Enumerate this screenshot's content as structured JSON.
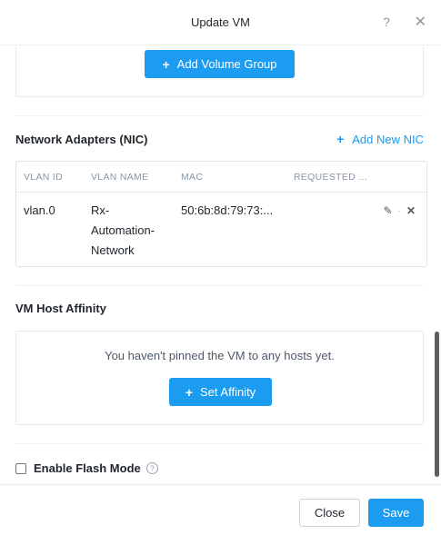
{
  "header": {
    "title": "Update VM",
    "help_icon": "?",
    "close_icon": "✕"
  },
  "volume": {
    "add_label": "Add Volume Group"
  },
  "nic": {
    "title": "Network Adapters (NIC)",
    "add_label": "Add New NIC",
    "columns": [
      "VLAN ID",
      "VLAN NAME",
      "MAC",
      "REQUESTED ..."
    ],
    "rows": [
      {
        "vlan_id": "vlan.0",
        "vlan_name_lines": [
          "Rx-",
          "Automation-",
          "Network"
        ],
        "mac": "50:6b:8d:79:73:..."
      }
    ]
  },
  "affinity": {
    "title": "VM Host Affinity",
    "empty_message": "You haven't pinned the VM to any hosts yet.",
    "set_label": "Set Affinity"
  },
  "flash": {
    "label": "Enable Flash Mode",
    "checked": false
  },
  "footer": {
    "close_label": "Close",
    "save_label": "Save"
  },
  "colors": {
    "primary": "#1b9cf0",
    "text": "#22272e",
    "muted": "#8a96a3"
  }
}
